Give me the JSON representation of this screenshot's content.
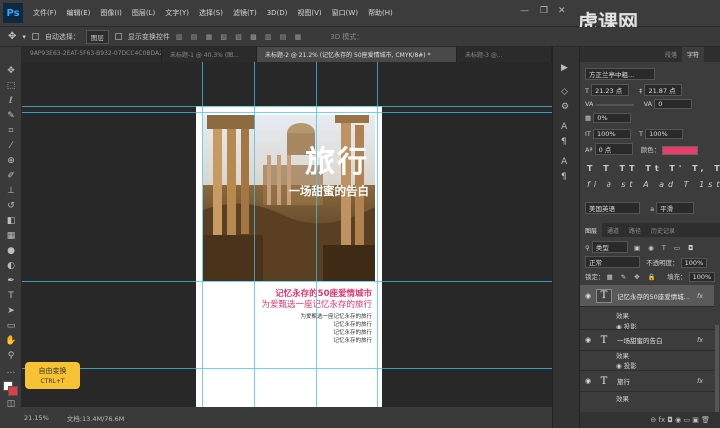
{
  "menu": {
    "logo": "Ps",
    "items": [
      "文件(F)",
      "编辑(E)",
      "图像(I)",
      "图层(L)",
      "文字(Y)",
      "选择(S)",
      "滤镜(T)",
      "3D(D)",
      "视图(V)",
      "窗口(W)",
      "帮助(H)"
    ],
    "minimize": "—",
    "restore": "❐",
    "close": "✕"
  },
  "watermark": "虎课网",
  "options": {
    "auto_select_label": "自动选择：",
    "auto_select_value": "图层",
    "show_transform_label": "显示变换控件",
    "mode_3d": "3D 模式："
  },
  "tabs": [
    "9AP93E63-2EAT-5F63-B932-07DCC4C0BDA2.jpg",
    "未标题-1 @ 40.3% (图...",
    "未标题-2 @ 21.2% (记忆永存的 50座爱情城市, CMYK/8#) *",
    "未标题-3 @..."
  ],
  "poster": {
    "title": "旅行",
    "subtitle": "一场甜蜜的告白",
    "pink_line1": "记忆永存的50座爱情城市",
    "pink_line2": "为爱甄选一座记忆永存的旅行",
    "small_lines": [
      "为爱甄选一座记忆永存的旅行",
      "记忆永存的旅行",
      "记忆永存的旅行",
      "记忆永存的旅行"
    ]
  },
  "tooltip": {
    "title": "自由变换",
    "shortcut": "CTRL+T"
  },
  "status": {
    "zoom": "21.15%",
    "doc": "文档:13.4M/76.6M"
  },
  "char_panel": {
    "tabs": [
      "段落",
      "字符"
    ],
    "font_family": "方正兰亭中粗...",
    "font_size": "21.23 点",
    "leading": "21.87 点",
    "kerning": "",
    "tracking": "0",
    "tracking_pct": "0%",
    "vscale": "100%",
    "hscale": "100%",
    "baseline": "0 点",
    "color_label": "颜色：",
    "color": "#e83c6a",
    "type_buttons": "T T TT Tt T' T, T T",
    "ot_buttons": "fi ∂ st A ad T 1st ½",
    "language": "美国英语",
    "antialias": "a",
    "antialias_value": "平滑"
  },
  "layers_panel": {
    "tabs": [
      "图层",
      "通道",
      "路径",
      "历史记录"
    ],
    "filter": "类型",
    "blend": "正常",
    "opacity_label": "不透明度：",
    "opacity": "100%",
    "lock_label": "锁定：",
    "fill_label": "填充：",
    "fill": "100%",
    "layers": [
      {
        "name": "记忆永存的50座爱情城...",
        "fx": "fx",
        "effects_label": "效果",
        "effect": "投影"
      },
      {
        "name": "一场甜蜜的告白",
        "fx": "fx",
        "effects_label": "效果",
        "effect": "投影"
      },
      {
        "name": "旅行",
        "fx": "fx",
        "effects_label": "效果"
      }
    ],
    "bottom_icons": "⊖ fx ◘ ◉ ▭ ▣ 🗑"
  }
}
